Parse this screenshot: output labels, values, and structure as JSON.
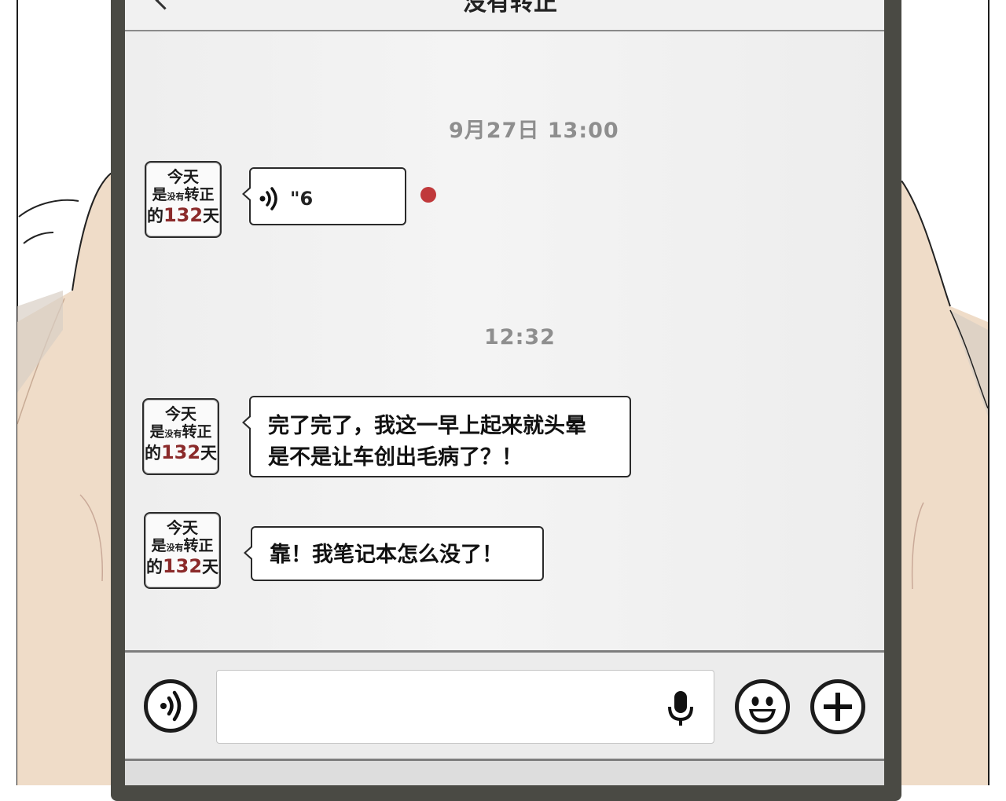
{
  "header": {
    "title": "没有转正"
  },
  "chat": {
    "timestamp_1": "9月27日 13:00",
    "timestamp_2": "12:32",
    "avatar": {
      "line1": "今天",
      "line2_pre": "是",
      "line2_small": "没有",
      "line2_post": "转正",
      "line3_pre": "的",
      "line3_num": "132",
      "line3_post": "天"
    },
    "messages": [
      {
        "type": "voice",
        "duration": "\"6",
        "unread": true
      },
      {
        "type": "text",
        "lines": [
          "完了完了，我这一早上起来就头晕",
          "是不是让车创出毛病了？！"
        ]
      },
      {
        "type": "text",
        "lines": [
          "靠！我笔记本怎么没了！"
        ]
      }
    ]
  },
  "input_bar": {
    "voice_icon": "voice-toggle-icon",
    "mic_icon": "microphone-icon",
    "emoji_icon": "smiley-icon",
    "plus_icon": "plus-circle-icon",
    "placeholder": ""
  },
  "colors": {
    "unread_dot": "#c0393b",
    "avatar_number": "#8b2a2a",
    "timestamp": "#8e8e8e"
  }
}
